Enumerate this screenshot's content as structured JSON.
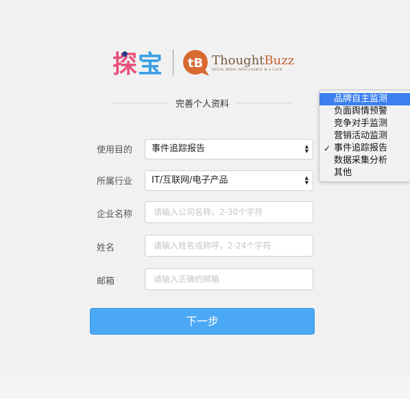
{
  "logo": {
    "tanbao_char1": "探",
    "tanbao_char2": "宝",
    "thought": "Thought",
    "buzz": "Buzz",
    "tagline": "SOCIAL MEDIA INTELLIGENCE IN A CLICK"
  },
  "page": {
    "title": "完善个人资料"
  },
  "form": {
    "purpose": {
      "label": "使用目的",
      "value": "事件追踪报告"
    },
    "industry": {
      "label": "所属行业",
      "value": "IT/互联网/电子产品"
    },
    "company": {
      "label": "企业名称",
      "placeholder": "请输入公司名称，2-30个字符"
    },
    "name": {
      "label": "姓名",
      "placeholder": "请输入姓名或称呼，2-24个字符"
    },
    "email": {
      "label": "邮箱",
      "placeholder": "请输入正确的邮箱"
    },
    "submit_label": "下一步"
  },
  "dropdown": {
    "options": [
      {
        "label": "品牌自主监测",
        "highlighted": true,
        "checked": false
      },
      {
        "label": "负面舆情预警",
        "highlighted": false,
        "checked": false
      },
      {
        "label": "竞争对手监测",
        "highlighted": false,
        "checked": false
      },
      {
        "label": "营销活动监测",
        "highlighted": false,
        "checked": false
      },
      {
        "label": "事件追踪报告",
        "highlighted": false,
        "checked": true
      },
      {
        "label": "数据采集分析",
        "highlighted": false,
        "checked": false
      },
      {
        "label": "其他",
        "highlighted": false,
        "checked": false
      }
    ]
  },
  "colors": {
    "accent": "#4aa8f4",
    "highlight": "#3b7ff0",
    "tanbao_pink": "#e8527a",
    "tanbao_blue": "#3aa0e6"
  }
}
